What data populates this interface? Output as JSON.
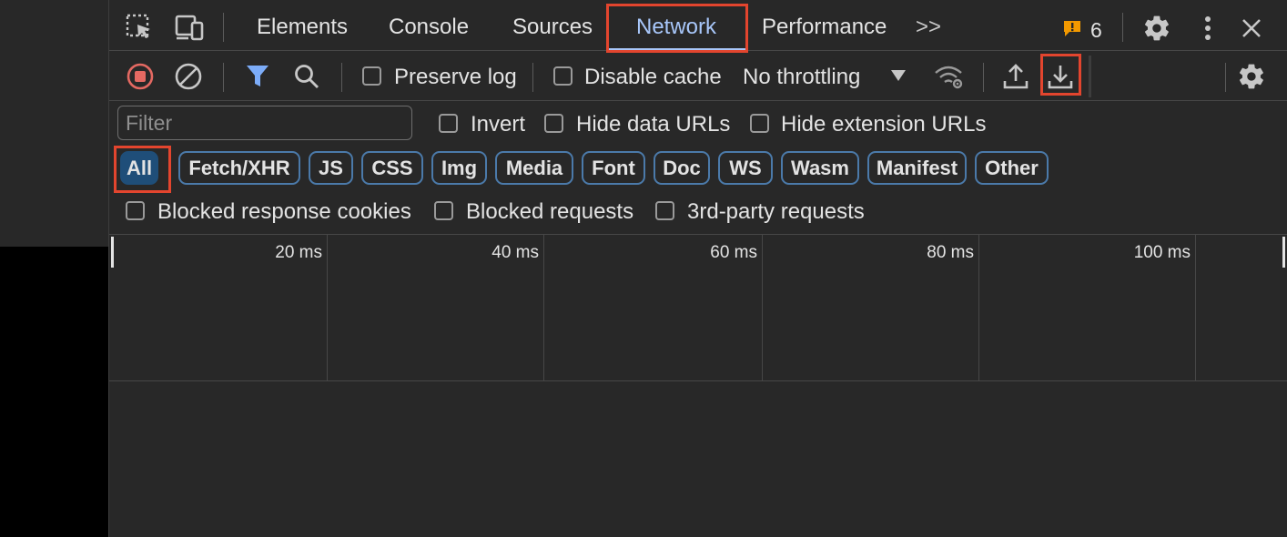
{
  "tabs": [
    {
      "label": "Elements"
    },
    {
      "label": "Console"
    },
    {
      "label": "Sources"
    },
    {
      "label": "Network",
      "active": true
    },
    {
      "label": "Performance"
    }
  ],
  "more_tabs_label": ">>",
  "issues_count": "6",
  "toolbar": {
    "preserve_log": "Preserve log",
    "disable_cache": "Disable cache",
    "throttling": "No throttling"
  },
  "filter": {
    "placeholder": "Filter",
    "invert": "Invert",
    "hide_data_urls": "Hide data URLs",
    "hide_extension_urls": "Hide extension URLs"
  },
  "type_filters": [
    "All",
    "Fetch/XHR",
    "JS",
    "CSS",
    "Img",
    "Media",
    "Font",
    "Doc",
    "WS",
    "Wasm",
    "Manifest",
    "Other"
  ],
  "blocked": {
    "response_cookies": "Blocked response cookies",
    "requests": "Blocked requests",
    "third_party": "3rd-party requests"
  },
  "timeline_ticks": [
    "20 ms",
    "40 ms",
    "60 ms",
    "80 ms",
    "100 ms"
  ],
  "colors": {
    "accent": "#a8c7fa",
    "record_red": "#e46962",
    "highlight": "#e3452e",
    "warning": "#f29900"
  }
}
